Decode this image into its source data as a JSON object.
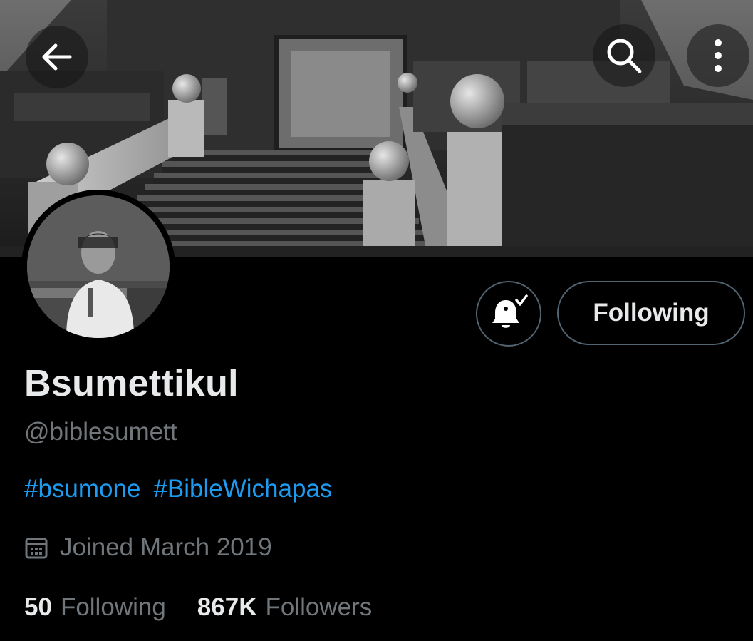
{
  "header": {
    "back_icon": "arrow-left-icon",
    "search_icon": "search-icon",
    "more_icon": "more-vertical-icon"
  },
  "banner": {
    "description_icon": "banner-image"
  },
  "actions": {
    "notifications_icon": "bell-check-icon",
    "follow_label": "Following"
  },
  "profile": {
    "display_name": "Bsumettikul",
    "handle": "@biblesumett",
    "bio_hashtags": [
      "#bsumone",
      "#BibleWichapas"
    ],
    "joined_icon": "calendar-icon",
    "joined": "Joined March 2019"
  },
  "stats": {
    "following_count": "50",
    "following_label": "Following",
    "followers_count": "867K",
    "followers_label": "Followers"
  },
  "colors": {
    "background": "#000000",
    "primary_text": "#e7e9ea",
    "secondary_text": "#71767b",
    "link": "#1d9bf0",
    "border": "#536471"
  }
}
